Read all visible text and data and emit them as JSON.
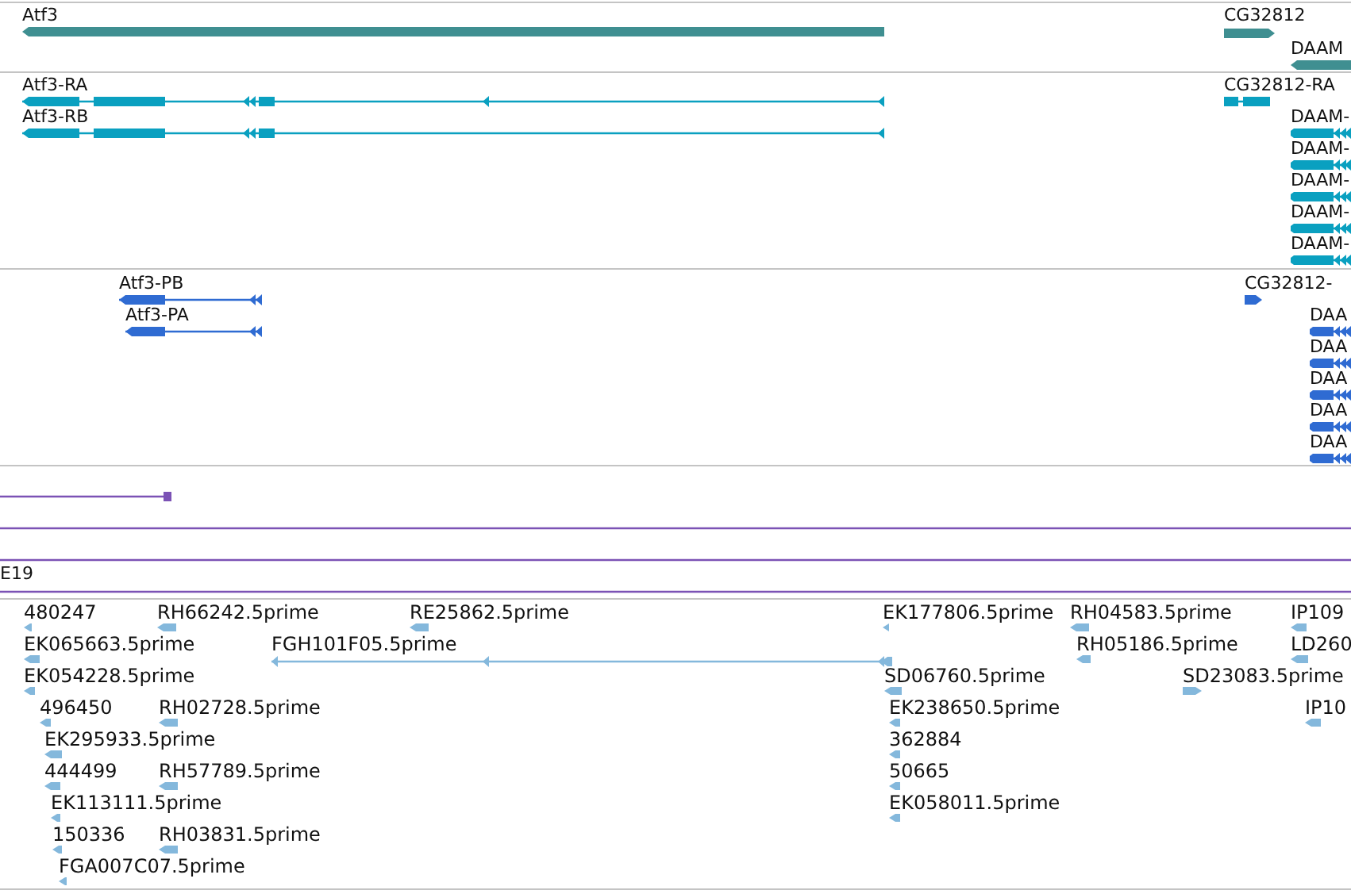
{
  "tracks": [
    {
      "kind": "gene",
      "features": [
        {
          "label": "Atf3",
          "reverse": true
        },
        {
          "label": "CG32812",
          "reverse": false
        },
        {
          "label": "DAAM",
          "reverse": true
        }
      ]
    },
    {
      "kind": "transcript",
      "features": [
        {
          "label": "Atf3-RA",
          "reverse": true
        },
        {
          "label": "Atf3-RB",
          "reverse": true
        },
        {
          "label": "CG32812-RA",
          "reverse": false
        },
        {
          "label": "DAAM-",
          "reverse": true
        },
        {
          "label": "DAAM-",
          "reverse": true
        },
        {
          "label": "DAAM-",
          "reverse": true
        },
        {
          "label": "DAAM-",
          "reverse": true
        },
        {
          "label": "DAAM-",
          "reverse": true
        }
      ]
    },
    {
      "kind": "protein",
      "features": [
        {
          "label": "Atf3-PB",
          "reverse": true
        },
        {
          "label": "Atf3-PA",
          "reverse": true
        },
        {
          "label": "CG32812-",
          "reverse": false
        },
        {
          "label": "DAA",
          "reverse": true
        },
        {
          "label": "DAA",
          "reverse": true
        },
        {
          "label": "DAA",
          "reverse": true
        },
        {
          "label": "DAA",
          "reverse": true
        },
        {
          "label": "DAA",
          "reverse": true
        }
      ]
    },
    {
      "kind": "alignment",
      "features": [
        {
          "label": "E19"
        }
      ]
    },
    {
      "kind": "est",
      "features": [
        {
          "label": "480247",
          "reverse": true
        },
        {
          "label": "RH66242.5prime",
          "reverse": true
        },
        {
          "label": "RE25862.5prime",
          "reverse": true
        },
        {
          "label": "EK177806.5prime",
          "reverse": true
        },
        {
          "label": "RH04583.5prime",
          "reverse": true
        },
        {
          "label": "IP109",
          "reverse": true
        },
        {
          "label": "EK065663.5prime",
          "reverse": true
        },
        {
          "label": "FGH101F05.5prime",
          "reverse": true
        },
        {
          "label": "RH05186.5prime",
          "reverse": true
        },
        {
          "label": "LD260",
          "reverse": true
        },
        {
          "label": "EK054228.5prime",
          "reverse": true
        },
        {
          "label": "SD06760.5prime",
          "reverse": true
        },
        {
          "label": "SD23083.5prime",
          "reverse": false
        },
        {
          "label": "496450",
          "reverse": true
        },
        {
          "label": "RH02728.5prime",
          "reverse": true
        },
        {
          "label": "EK238650.5prime",
          "reverse": true
        },
        {
          "label": "IP10",
          "reverse": true
        },
        {
          "label": "EK295933.5prime",
          "reverse": true
        },
        {
          "label": "362884",
          "reverse": true
        },
        {
          "label": "444499",
          "reverse": true
        },
        {
          "label": "RH57789.5prime",
          "reverse": true
        },
        {
          "label": "50665",
          "reverse": true
        },
        {
          "label": "EK113111.5prime",
          "reverse": true
        },
        {
          "label": "EK058011.5prime",
          "reverse": true
        },
        {
          "label": "150336",
          "reverse": true
        },
        {
          "label": "RH03831.5prime",
          "reverse": true
        },
        {
          "label": "FGA007C07.5prime",
          "reverse": true
        }
      ]
    }
  ]
}
